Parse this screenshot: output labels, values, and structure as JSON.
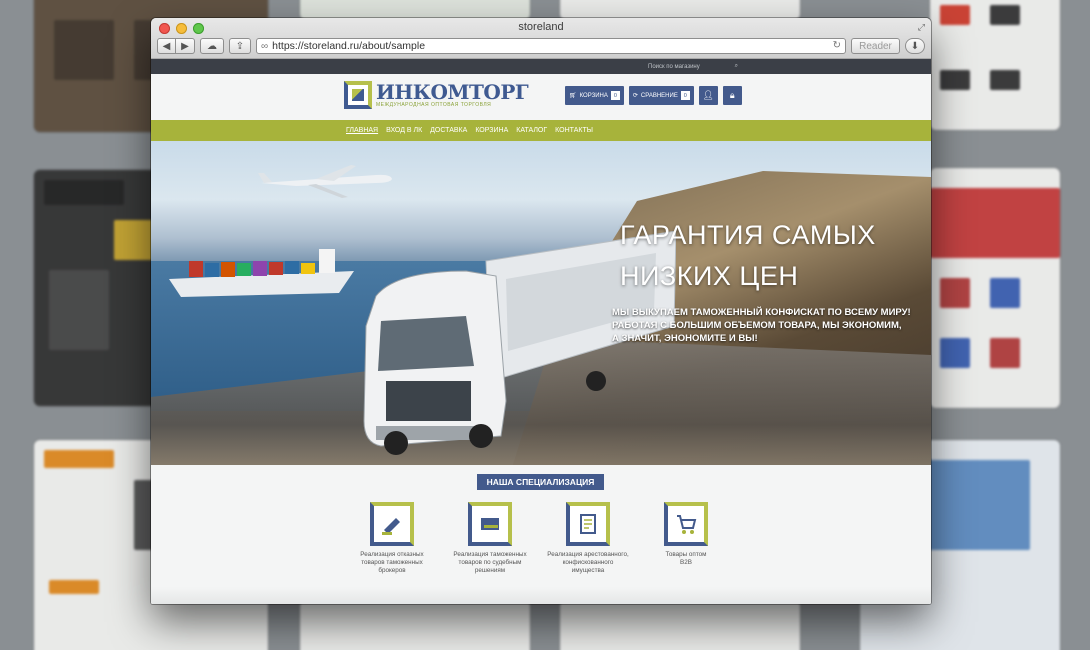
{
  "window": {
    "title": "storeland",
    "url": "https://storeland.ru/about/sample",
    "reader_label": "Reader"
  },
  "site": {
    "search_placeholder": "Поиск по магазину",
    "logo": {
      "name": "ИНКОМТОРГ",
      "tagline": "МЕЖДУНАРОДНАЯ ОПТОВАЯ ТОРГОВЛЯ"
    },
    "header_buttons": {
      "cart_label": "КОРЗИНА",
      "cart_count": "0",
      "compare_label": "СРАВНЕНИЕ",
      "compare_count": "0"
    },
    "menu": [
      {
        "label": "ГЛАВНАЯ"
      },
      {
        "label": "ВХОД В ЛК"
      },
      {
        "label": "ДОСТАВКА"
      },
      {
        "label": "КОРЗИНА"
      },
      {
        "label": "КАТАЛОГ"
      },
      {
        "label": "КОНТАКТЫ"
      }
    ],
    "hero": {
      "title_line1": "ГАРАНТИЯ САМЫХ",
      "title_line2": "НИЗКИХ ЦЕН",
      "sub_line1": "МЫ ВЫКУПАЕМ ТАМОЖЕННЫЙ КОНФИСКАТ ПО ВСЕМУ МИРУ!",
      "sub_line2": "РАБОТАЯ С БОЛЬШИМ ОБЪЕМОМ ТОВАРА, МЫ ЭКОНОМИМ,",
      "sub_line3": "А ЗНАЧИТ, ЭНОНОМИТЕ И ВЫ!"
    },
    "specialization": {
      "title": "НАША СПЕЦИАЛИЗАЦИЯ",
      "items": [
        {
          "icon": "stamp-icon",
          "line1": "Реализация отказных",
          "line2": "товаров таможенных",
          "line3": "брокеров"
        },
        {
          "icon": "gavel-icon",
          "line1": "Реализация таможенных",
          "line2": "товаров по судебным",
          "line3": "решениям"
        },
        {
          "icon": "document-icon",
          "line1": "Реализация арестованного,",
          "line2": "конфискованного имущества",
          "line3": ""
        },
        {
          "icon": "cart-icon",
          "line1": "Товары оптом",
          "line2": "B2B",
          "line3": ""
        }
      ]
    }
  },
  "colors": {
    "brand_blue": "#435a8c",
    "brand_green": "#a7b33b"
  }
}
